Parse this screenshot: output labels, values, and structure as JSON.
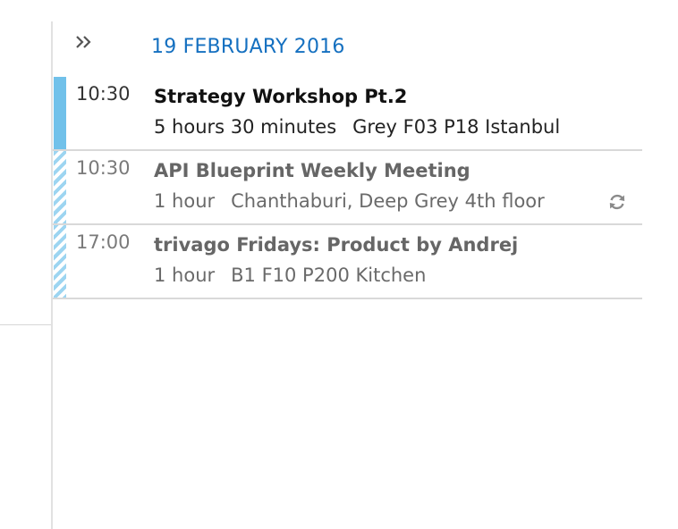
{
  "calendar_peek": {
    "expand_icon": "double-chevron-right-icon",
    "date_header": "19 FEBRUARY 2016",
    "appointments": [
      {
        "time": "10:30",
        "title": "Strategy Workshop Pt.2",
        "duration": "5 hours 30 minutes",
        "location": "Grey F03 P18 Istanbul",
        "status": "busy",
        "recurring": false
      },
      {
        "time": "10:30",
        "title": "API Blueprint Weekly Meeting",
        "duration": "1 hour",
        "location": "Chanthaburi, Deep Grey 4th floor",
        "status": "tentative",
        "recurring": true,
        "recurring_icon": "recurrence-icon"
      },
      {
        "time": "17:00",
        "title": "trivago Fridays: Product by Andrej",
        "duration": "1 hour",
        "location": "B1 F10 P200 Kitchen",
        "status": "tentative",
        "recurring": false
      }
    ]
  },
  "colors": {
    "accent_date": "#1570c0",
    "busy_bar": "#71c1ea",
    "tentative_bar": "#9dd5f1"
  }
}
